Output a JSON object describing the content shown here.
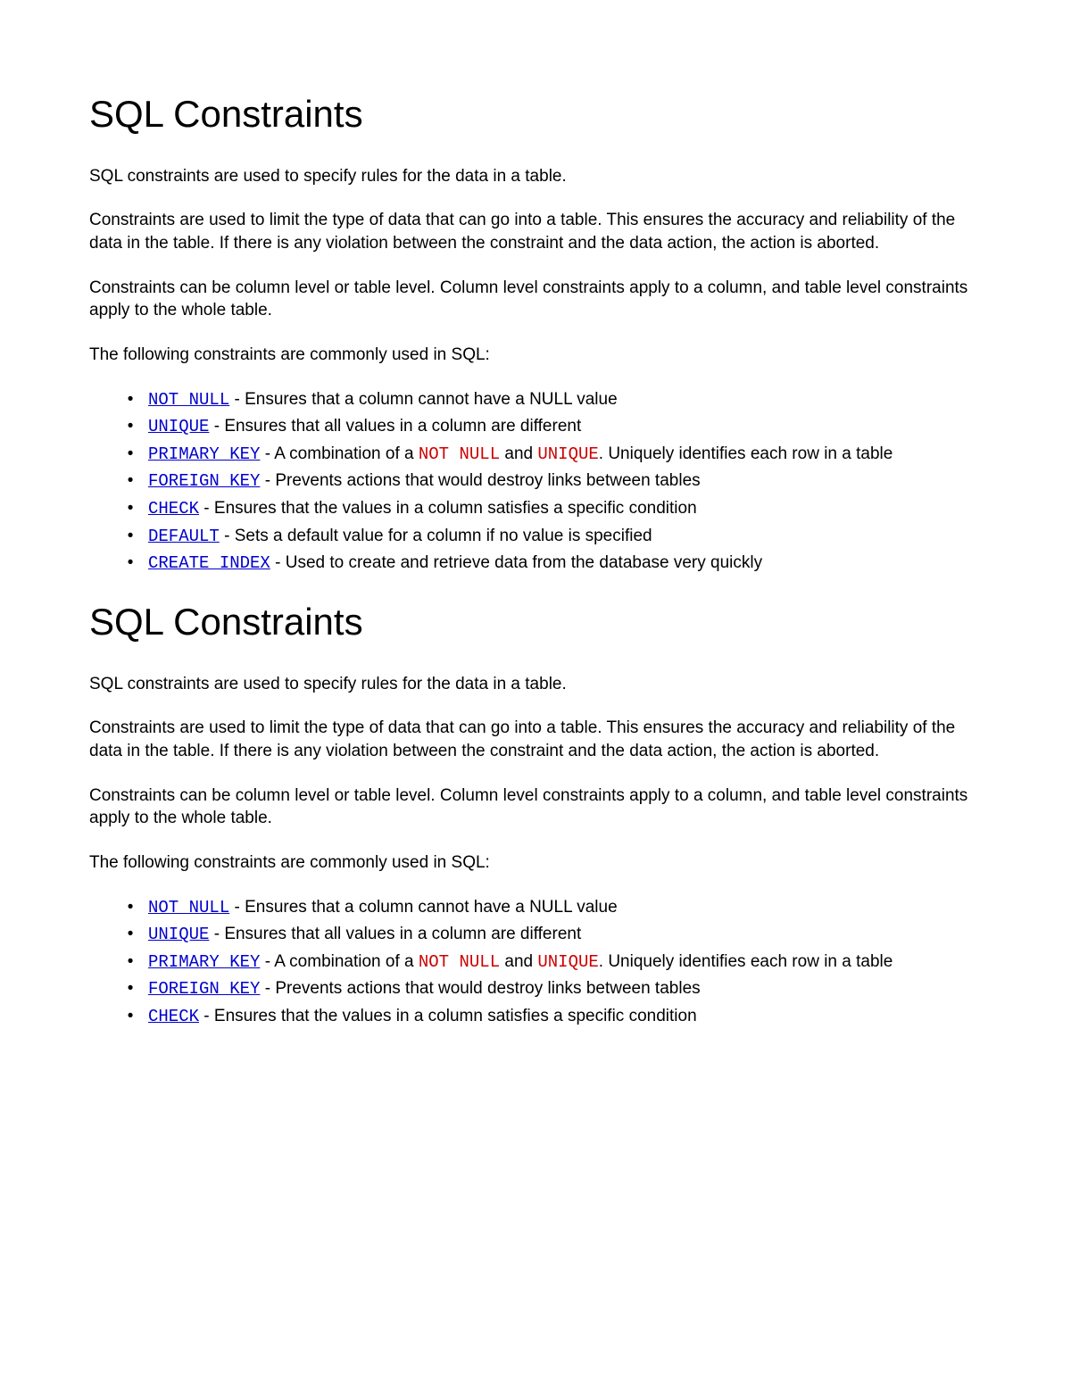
{
  "sections": [
    {
      "heading": "SQL Constraints",
      "paragraphs": [
        "SQL constraints are used to specify rules for the data in a table.",
        "Constraints are used to limit the type of data that can go into a table. This ensures the accuracy and reliability of the data in the table. If there is any violation between the constraint and the data action, the action is aborted.",
        "Constraints can be column level or table level. Column level constraints apply to a column, and table level constraints apply to the whole table.",
        "The following constraints are commonly used in SQL:"
      ],
      "items": [
        {
          "link": "NOT NULL",
          "sep": " - ",
          "desc": "Ensures that a column cannot have a NULL value"
        },
        {
          "link": "UNIQUE",
          "sep": " - ",
          "desc": "Ensures that all values in a column are different"
        },
        {
          "link": "PRIMARY KEY",
          "sep": " - ",
          "pre": "A combination of a ",
          "code1": "NOT NULL",
          "mid": " and ",
          "code2": "UNIQUE",
          "post": ". Uniquely identifies each row in a table"
        },
        {
          "link": "FOREIGN KEY",
          "sep": " - ",
          "desc": "Prevents actions that would destroy links between tables"
        },
        {
          "link": "CHECK",
          "sep": " - ",
          "desc": "Ensures that the values in a column satisfies a specific condition"
        },
        {
          "link": "DEFAULT",
          "sep": " - ",
          "desc": "Sets a default value for a column if no value is specified"
        },
        {
          "link": "CREATE INDEX",
          "sep": " - ",
          "desc": "Used to create and retrieve data from the database very quickly"
        }
      ]
    },
    {
      "heading": "SQL Constraints",
      "paragraphs": [
        "SQL constraints are used to specify rules for the data in a table.",
        "Constraints are used to limit the type of data that can go into a table. This ensures the accuracy and reliability of the data in the table. If there is any violation between the constraint and the data action, the action is aborted.",
        "Constraints can be column level or table level. Column level constraints apply to a column, and table level constraints apply to the whole table.",
        "The following constraints are commonly used in SQL:"
      ],
      "items": [
        {
          "link": "NOT NULL",
          "sep": " - ",
          "desc": "Ensures that a column cannot have a NULL value"
        },
        {
          "link": "UNIQUE",
          "sep": " - ",
          "desc": "Ensures that all values in a column are different"
        },
        {
          "link": "PRIMARY KEY",
          "sep": " - ",
          "pre": "A combination of a ",
          "code1": "NOT NULL",
          "mid": " and ",
          "code2": "UNIQUE",
          "post": ". Uniquely identifies each row in a table"
        },
        {
          "link": "FOREIGN KEY",
          "sep": " - ",
          "desc": "Prevents actions that would destroy links between tables"
        },
        {
          "link": "CHECK",
          "sep": " - ",
          "desc": "Ensures that the values in a column satisfies a specific condition"
        }
      ]
    }
  ]
}
